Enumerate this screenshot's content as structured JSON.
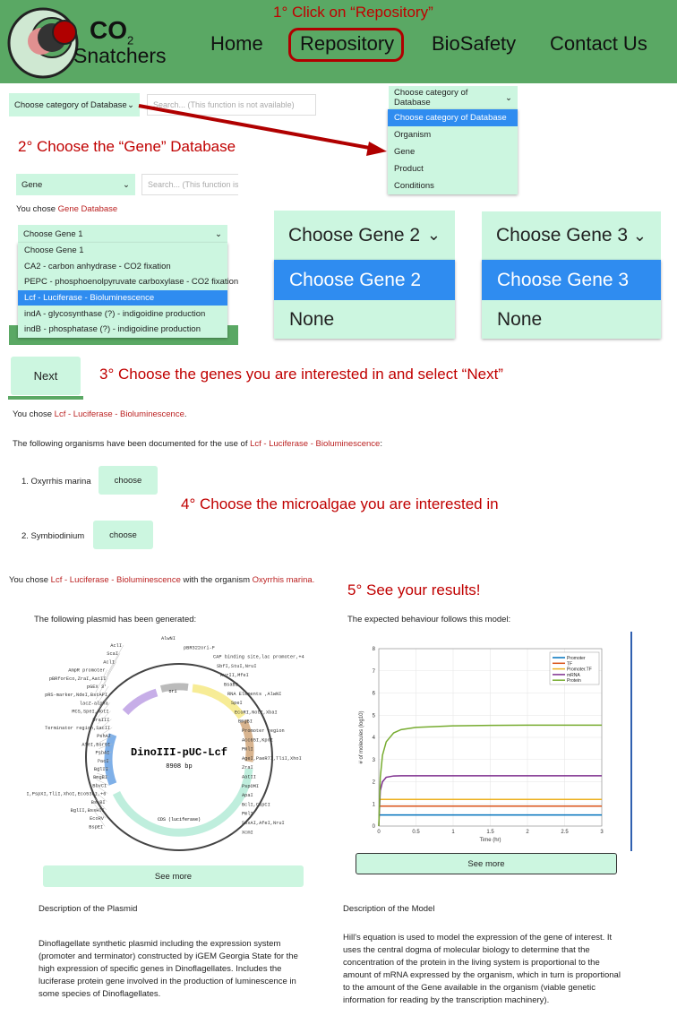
{
  "header": {
    "logo_line1": "CO",
    "logo_sub": "2",
    "logo_line2": "Snatchers",
    "nav": [
      "Home",
      "Repository",
      "BioSafety",
      "Contact Us"
    ]
  },
  "annotations": {
    "step1": "1° Click on “Repository”",
    "step2": "2° Choose the “Gene” Database",
    "step3": "3° Choose the genes you are interested in and select “Next”",
    "step4": "4° Choose the microalgae you are interested in",
    "step5": "5° See your results!"
  },
  "colors": {
    "header": "#5aa864",
    "mint": "#ccf6e0",
    "highlight": "#2f8cf0",
    "annotation": "#c00000"
  },
  "db_select": {
    "value": "Choose category of Database",
    "search_placeholder": "Search... (This function is not available)"
  },
  "db_dropdown": {
    "value": "Choose category of Database",
    "options": [
      "Choose category of Database",
      "Organism",
      "Gene",
      "Product",
      "Conditions"
    ]
  },
  "gene_db": {
    "value": "Gene",
    "search_placeholder": "Search... (This function is n",
    "chose_prefix": "You chose",
    "chose_value": "Gene Database"
  },
  "gene1": {
    "value": "Choose Gene 1",
    "options": [
      "Choose Gene 1",
      "CA2 - carbon anhydrase - CO2 fixation",
      "PEPC - phosphoenolpyruvate carboxylase - CO2 fixation",
      "Lcf - Luciferase - Bioluminescence",
      "indA - glycosynthase (?) - indigoidine production",
      "indB - phosphatase (?) - indigoidine production"
    ]
  },
  "gene2": {
    "value": "Choose Gene 2",
    "options": [
      "Choose Gene 2",
      "None"
    ]
  },
  "gene3": {
    "value": "Choose Gene 3",
    "options": [
      "Choose Gene 3",
      "None"
    ]
  },
  "next_label": "Next",
  "result": {
    "chose_prefix": "You chose",
    "gene": "Lcf - Luciferase - Bioluminescence",
    "organisms_intro": "The following organisms have been documented for the use of",
    "organisms": [
      "1. Oxyrrhis marina",
      "2. Symbiodinium"
    ],
    "choose_label": "choose",
    "with_organism": "with the organism",
    "organism": "Oxyrrhis marina."
  },
  "plasmid": {
    "intro": "The following plasmid has been generated:",
    "name": "DinoIII-pUC-Lcf",
    "size": "8908 bp",
    "labels_left": [
      "AclI",
      "ScaI",
      "AclI",
      "AmpR promoter",
      "pBRforEco,ZraI,AatII",
      "pGEX 3'",
      "pRS-marker,NdeI,BstAPI",
      "lacZ-alpha",
      "MCS,SpeI,NotI",
      "DraIII",
      "Terminator region,SacII",
      "PshAI",
      "AfeI,BsrGI",
      "PshAI",
      "PacI",
      "BglII",
      "BmgBI",
      "BbvCI",
      "PaeR7I,PspXI,TliI,XhoI,Eco53kI,+6",
      "BstBI",
      "BglII,BssHII",
      "EcoRV",
      "BspEI"
    ],
    "labels_right": [
      "AlwNI",
      "pBR322ori-F",
      "CAP binding site,lac promoter,+4",
      "SbfI,StuI,NruI",
      "AvrII,MfeI",
      "BsaBI",
      "RNA Elements ,AlwNI",
      "SpeI",
      "EcoRI,NotI,XbaI",
      "BmgBI",
      "Promoter region",
      "Acc65I,KpnI",
      "PmlI",
      "AgeI,PaeR7I,TliI,XhoI",
      "ZraI",
      "AatII",
      "PspOMI",
      "ApaI",
      "BclI,CspCI",
      "PmlI",
      "SexAI,AfeI,NruI",
      "XcmI"
    ],
    "features": [
      "ori",
      "MCS",
      "CDS (luciferase)",
      "AmpR"
    ],
    "see_more": "See more",
    "desc_title": "Description of the Plasmid",
    "description": "Dinoflagellate synthetic plasmid including the expression system (promoter and terminator) constructed by iGEM Georgia State for the high expression of specific genes in Dinoflagellates. Includes the luciferase protein gene involved in the production of luminescence in some species of Dinoflagellates."
  },
  "model": {
    "intro": "The expected behaviour follows this model:",
    "see_more": "See more",
    "desc_title": "Description of the Model",
    "description": "Hill's equation is used to model the expression of the gene of interest. It uses the central dogma of molecular biology to determine that the concentration of the protein in the living system is proportional to the amount of mRNA expressed by the organism, which in turn is proportional to the amount of the Gene available in the organism (viable genetic information for reading by the transcription machinery)."
  },
  "chart_data": {
    "type": "line",
    "xlabel": "Time (hr)",
    "ylabel": "# of molecules (log10)",
    "xlim": [
      0,
      3
    ],
    "ylim": [
      0,
      8
    ],
    "xticks": [
      "0",
      "0.5",
      "1",
      "1.5",
      "2",
      "2.5",
      "3"
    ],
    "yticks": [
      "0",
      "1",
      "2",
      "3",
      "4",
      "5",
      "6",
      "7",
      "8"
    ],
    "grid": true,
    "legend": "top-right",
    "x": [
      0,
      0.02,
      0.05,
      0.1,
      0.2,
      0.3,
      0.5,
      1,
      1.5,
      2,
      2.5,
      3
    ],
    "series": [
      {
        "name": "Promoter",
        "color": "#0072bd",
        "values": [
          0.5,
          0.5,
          0.5,
          0.5,
          0.5,
          0.5,
          0.5,
          0.5,
          0.5,
          0.5,
          0.5,
          0.5
        ]
      },
      {
        "name": "TF",
        "color": "#d95319",
        "values": [
          0.9,
          0.9,
          0.9,
          0.9,
          0.9,
          0.9,
          0.9,
          0.9,
          0.9,
          0.9,
          0.9,
          0.9
        ]
      },
      {
        "name": "Promoter.TF",
        "color": "#edb120",
        "values": [
          1.2,
          1.2,
          1.2,
          1.2,
          1.2,
          1.2,
          1.2,
          1.2,
          1.2,
          1.2,
          1.2,
          1.2
        ]
      },
      {
        "name": "mRNA",
        "color": "#7e2f8e",
        "values": [
          0,
          1.6,
          2.0,
          2.2,
          2.26,
          2.27,
          2.27,
          2.27,
          2.27,
          2.27,
          2.27,
          2.27
        ]
      },
      {
        "name": "Protein",
        "color": "#77ac30",
        "values": [
          0,
          2.2,
          3.2,
          3.8,
          4.2,
          4.35,
          4.45,
          4.52,
          4.54,
          4.55,
          4.55,
          4.55
        ]
      }
    ]
  }
}
